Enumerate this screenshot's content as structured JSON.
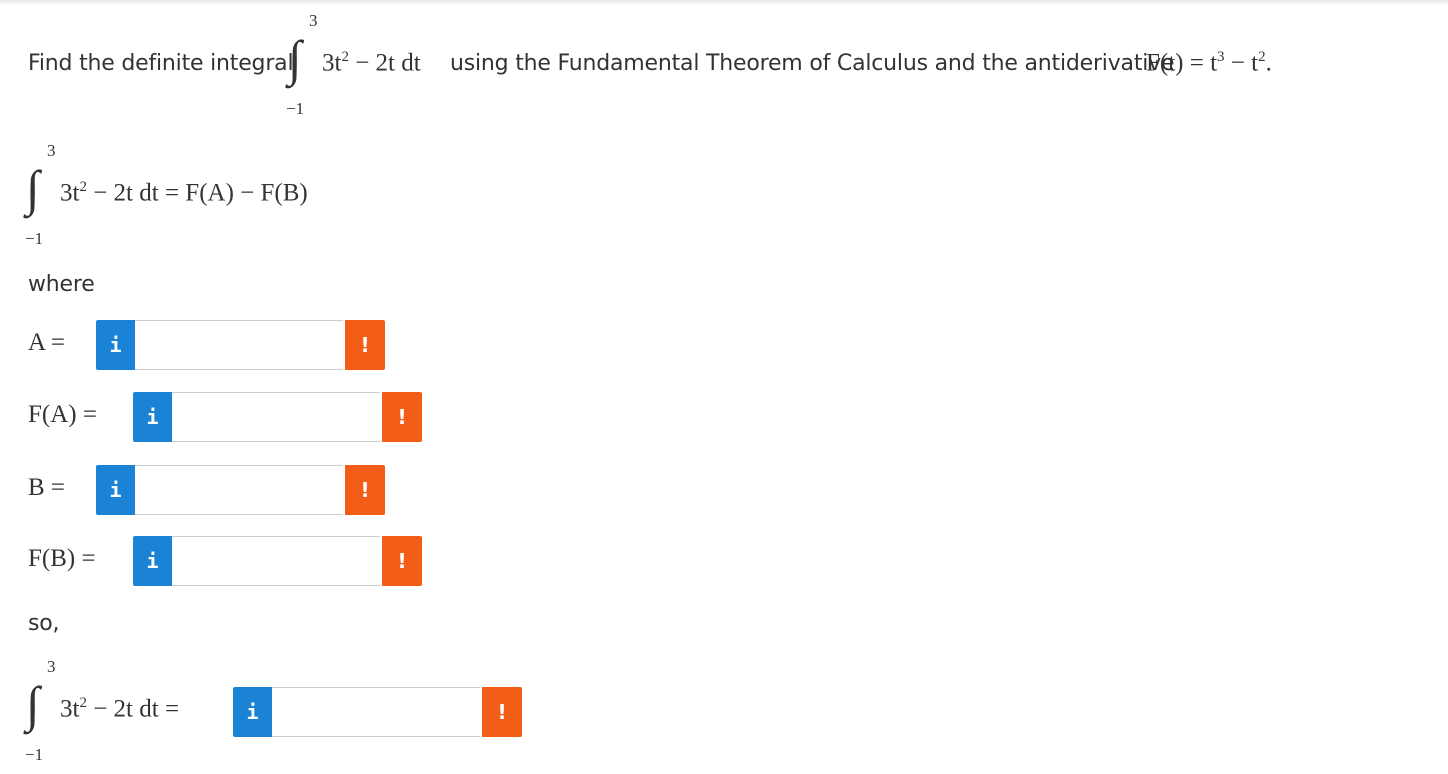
{
  "problem": {
    "prefix": "Find the definite integral",
    "integral": {
      "upper": "3",
      "lower": "−1",
      "integrand_coef": "3t",
      "integrand_exp": "2",
      "integrand_rest": " − 2t dt"
    },
    "middle": "using the Fundamental Theorem of Calculus and the antiderivative",
    "antiderivative": {
      "lhs": "F(t) = t",
      "exp1": "3",
      "minus": " − t",
      "exp2": "2",
      "end": "."
    }
  },
  "statement": {
    "upper": "3",
    "lower": "−1",
    "integrand_coef": "3t",
    "integrand_exp": "2",
    "integrand_rest": " − 2t dt = F(A) − F(B)"
  },
  "where_text": "where",
  "fields": [
    {
      "label": "A =",
      "info": "i",
      "warn": "!",
      "value": ""
    },
    {
      "label": "F(A) =",
      "info": "i",
      "warn": "!",
      "value": ""
    },
    {
      "label": "B =",
      "info": "i",
      "warn": "!",
      "value": ""
    },
    {
      "label": "F(B) =",
      "info": "i",
      "warn": "!",
      "value": ""
    }
  ],
  "so_text": "so,",
  "final": {
    "upper": "3",
    "lower": "−1",
    "integrand_coef": "3t",
    "integrand_exp": "2",
    "integrand_rest": " − 2t dt =",
    "info": "i",
    "warn": "!",
    "value": ""
  },
  "colors": {
    "info": "#1a83d6",
    "warn": "#f25d18",
    "text": "#333333"
  }
}
